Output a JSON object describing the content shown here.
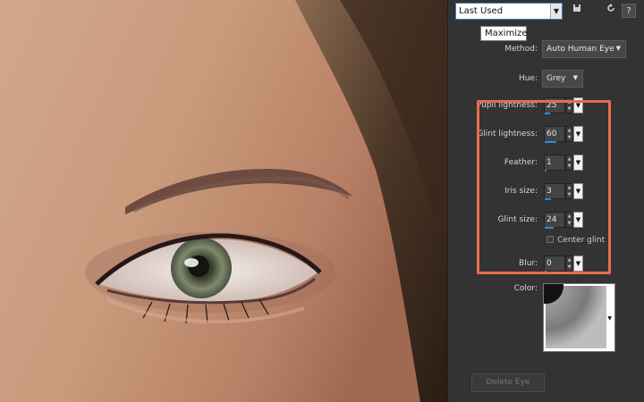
{
  "toolbar": {
    "preset_value": "Last Used",
    "help_label": "?"
  },
  "tooltip": {
    "text": "Maximize"
  },
  "method": {
    "label": "Method:",
    "value": "Auto Human Eye"
  },
  "hue": {
    "label": "Hue:",
    "value": "Grey"
  },
  "fields": [
    {
      "label": "Pupil lightness:",
      "value": "25",
      "fill": 0.25
    },
    {
      "label": "Glint lightness:",
      "value": "60",
      "fill": 0.6
    },
    {
      "label": "Feather:",
      "value": "1",
      "fill": 0.02
    },
    {
      "label": "Iris size:",
      "value": "3",
      "fill": 0.3
    },
    {
      "label": "Glint size:",
      "value": "24",
      "fill": 0.45
    },
    {
      "label": "Blur:",
      "value": "0",
      "fill": 0.0
    }
  ],
  "center_glint": {
    "label": "Center glint",
    "checked": false
  },
  "color": {
    "label": "Color:"
  },
  "delete_button": {
    "label": "Delete Eye",
    "enabled": false
  },
  "colors": {
    "highlight": "#e86c4d",
    "accent": "#2e8bd9",
    "panel": "#333333"
  },
  "icons": [
    "chevron-down-icon",
    "save-icon",
    "reset-icon",
    "help-icon",
    "spin-arrows-icon",
    "dropdown-arrow-icon"
  ]
}
